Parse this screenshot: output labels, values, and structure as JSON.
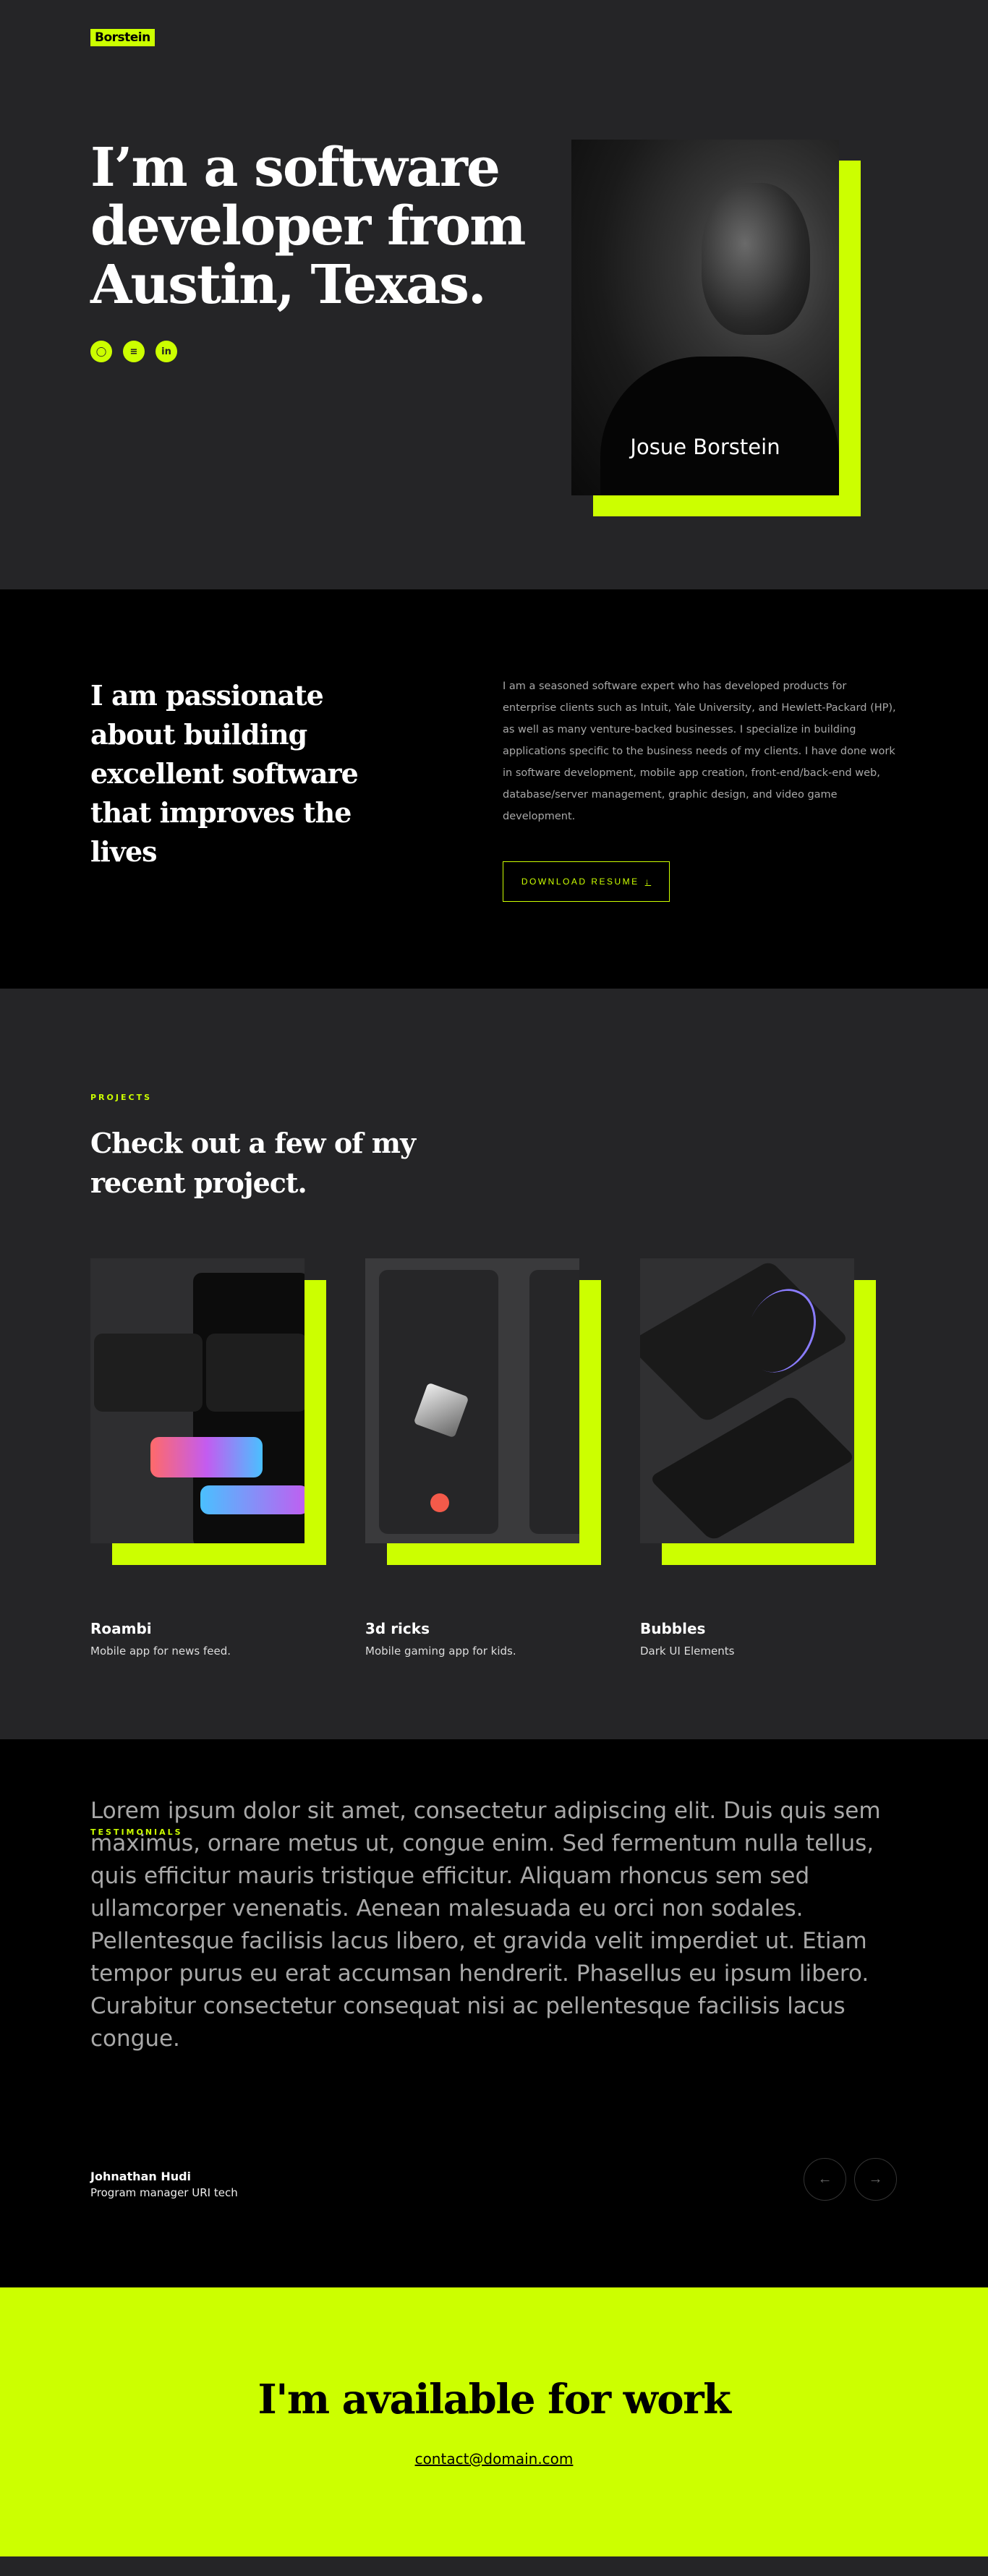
{
  "brand": {
    "logo": "Borstein",
    "accent": "#ccff00"
  },
  "hero": {
    "headline": "I’m a software developer from Austin, Texas.",
    "socials": [
      {
        "icon": "github-icon",
        "glyph": "◯"
      },
      {
        "icon": "stackoverflow-icon",
        "glyph": "≡"
      },
      {
        "icon": "linkedin-icon",
        "glyph": "in"
      }
    ],
    "photo_name": "Josue Borstein"
  },
  "about": {
    "heading": "I am passionate about building excellent software that improves the lives",
    "paragraph": "I am a seasoned software expert who has developed products for enterprise clients such as Intuit, Yale University, and Hewlett-Packard (HP), as well as many venture-backed businesses. I specialize in building applications specific to the business needs of my clients. I have done work in software development, mobile app creation, front-end/back-end web, database/server management, graphic design, and video game development.",
    "button": "DOWNLOAD RESUME",
    "button_icon": "download-icon"
  },
  "projects": {
    "label": "PROJECTS",
    "heading": "Check out a few of my recent project.",
    "items": [
      {
        "title": "Roambi",
        "subtitle": "Mobile app for news feed."
      },
      {
        "title": "3d ricks",
        "subtitle": "Mobile gaming app for kids."
      },
      {
        "title": "Bubbles",
        "subtitle": "Dark UI Elements"
      }
    ]
  },
  "testimonials": {
    "label": "TESTIMONIALS",
    "quote": "Lorem ipsum dolor sit amet, consectetur adipiscing elit. Duis quis sem maximus, ornare metus ut, congue enim. Sed fermentum nulla tellus, quis efficitur mauris tristique efficitur. Aliquam rhoncus sem sed ullamcorper venenatis. Aenean malesuada eu orci non sodales. Pellentesque facilisis lacus libero, et gravida velit imperdiet ut. Etiam tempor purus eu erat accumsan hendrerit. Phasellus eu ipsum libero. Curabitur consectetur consequat nisi ac pellentesque facilisis lacus congue.",
    "name": "Johnathan Hudi",
    "role": "Program manager URI tech",
    "prev": "←",
    "next": "→"
  },
  "cta": {
    "heading": "I'm available for work",
    "email": "contact@domain.com"
  }
}
